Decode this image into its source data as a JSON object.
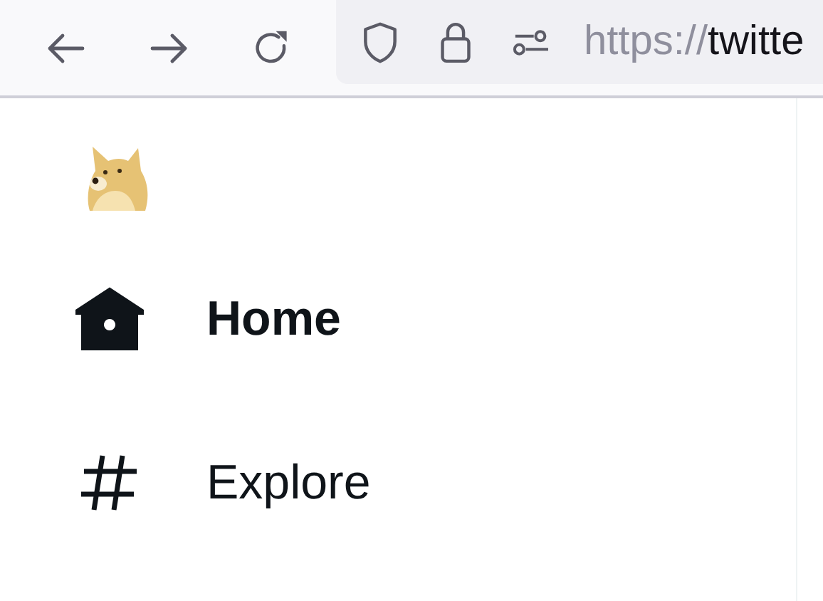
{
  "browser": {
    "url_scheme": "https://",
    "url_host": "twitte"
  },
  "sidebar": {
    "items": [
      {
        "kind": "home",
        "label": "Home",
        "selected": true
      },
      {
        "kind": "explore",
        "label": "Explore",
        "selected": false
      }
    ]
  }
}
